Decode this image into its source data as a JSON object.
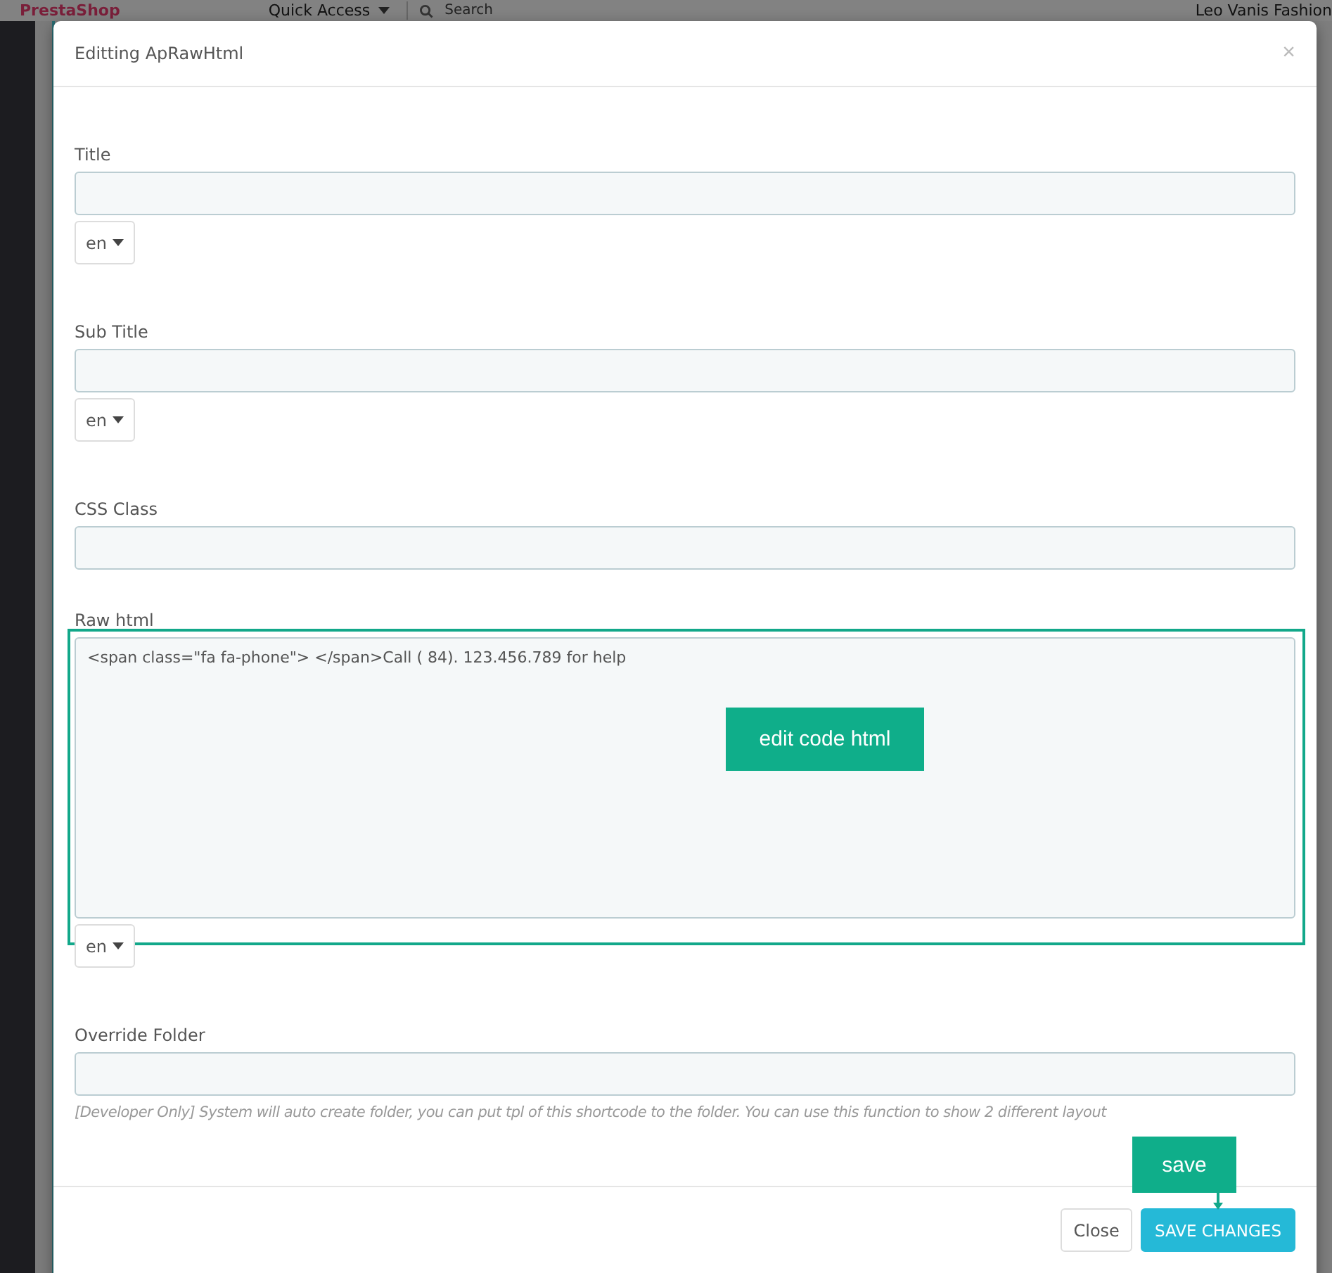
{
  "background": {
    "logo": "PrestaShop",
    "quick_access": "Quick Access",
    "search": {
      "placeholder": "Search"
    },
    "shop_name": "Leo Vanis Fashion"
  },
  "modal": {
    "title": "Editting ApRawHtml",
    "close": "×",
    "fields": [
      {
        "kind": "text",
        "label": "Title",
        "language": "en"
      },
      {
        "kind": "text",
        "label": "Sub Title",
        "language": "en"
      },
      {
        "kind": "text",
        "label": "CSS Class"
      },
      {
        "kind": "textarea",
        "label": "Raw html",
        "value": "<span class=\"fa fa-phone\"> </span>Call ( 84). 123.456.789 for help",
        "language": "en"
      },
      {
        "kind": "text",
        "label": "Override Folder",
        "help": "[Developer Only] System will auto create folder, you can put tpl of this shortcode to the folder. You can use this function to show 2 different layout"
      }
    ],
    "buttons": [
      {
        "label": "Close",
        "kind": "default"
      },
      {
        "label": "SAVE CHANGES",
        "kind": "primary"
      }
    ]
  },
  "annotations": [
    {
      "kind": "box",
      "text": "edit code html"
    },
    {
      "kind": "arrow",
      "text": "save"
    }
  ]
}
